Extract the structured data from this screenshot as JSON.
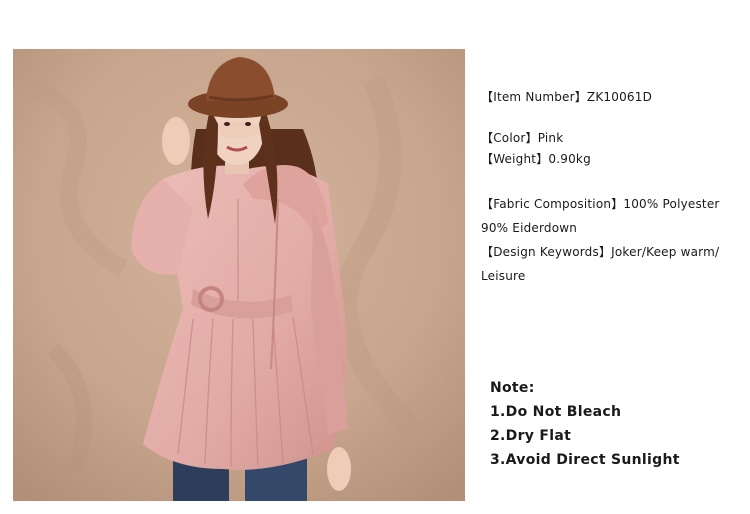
{
  "product": {
    "item_number": "【Item Number】ZK10061D",
    "color": "【Color】Pink",
    "weight": "【Weight】0.90kg",
    "fabric_line1": "【Fabric Composition】100% Polyester",
    "fabric_line2": "90% Eiderdown",
    "keywords_line1": "【Design Keywords】Joker/Keep warm/",
    "keywords_line2": "Leisure"
  },
  "notes": {
    "title": "Note:",
    "items": [
      "1.Do Not Bleach",
      "2.Dry Flat",
      "3.Avoid Direct Sunlight"
    ]
  },
  "colors": {
    "backdrop": "#c8a58d",
    "coat": "#e4aeaa",
    "hat": "#8a4e2f",
    "jeans": "#2c3e5c"
  }
}
